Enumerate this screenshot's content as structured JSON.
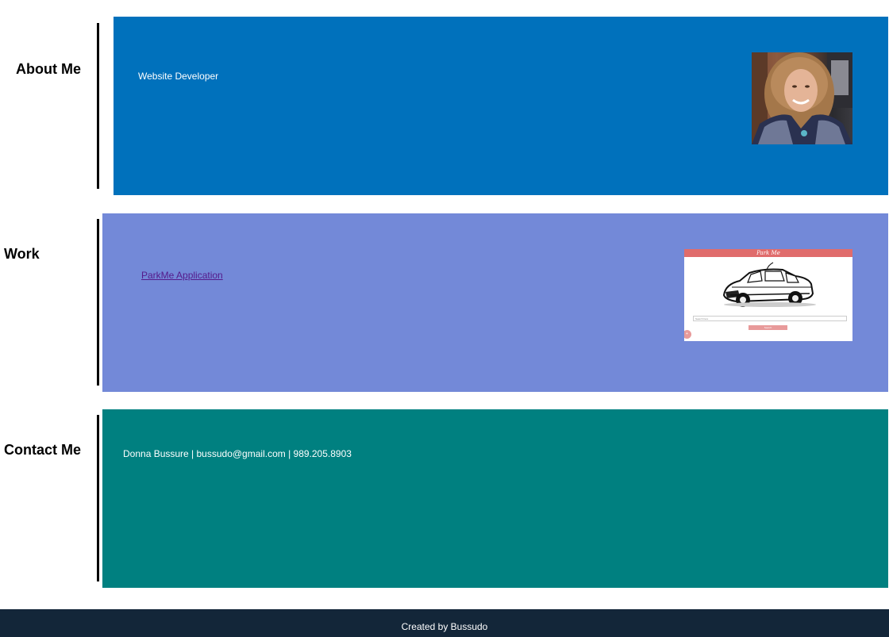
{
  "about": {
    "heading": "About Me",
    "text": "Website Developer",
    "photo_icon": "portrait-photo"
  },
  "work": {
    "heading": "Work",
    "link_label": "ParkMe Application",
    "thumbnail": {
      "icon": "app-screenshot",
      "header_title": "Park Me",
      "input_placeholder": "Search here",
      "button_label": "Search",
      "fab_label": "+"
    }
  },
  "contact": {
    "heading": "Contact Me",
    "text": "Donna Bussure | bussudo@gmail.com | 989.205.8903"
  },
  "footer": {
    "text": "Created by Bussudo"
  },
  "colors": {
    "about_bg": "#0071bc",
    "work_bg": "#7389d8",
    "contact_bg": "#008080",
    "footer_bg": "#132639",
    "link": "#551a8b"
  }
}
